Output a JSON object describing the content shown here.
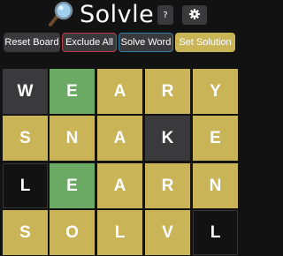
{
  "app": {
    "title": "Solvle",
    "help_label": "?",
    "icons": {
      "title": "magnifier-icon",
      "settings": "gear-icon"
    }
  },
  "toolbar": {
    "reset_label": "Reset Board",
    "exclude_label": "Exclude All",
    "solve_label": "Solve Word",
    "set_label": "Set Solution"
  },
  "colors": {
    "yellow": "#c9b458",
    "green": "#6aaa64",
    "gray": "#3a3a3c",
    "black": "#121213"
  },
  "board": {
    "rows": [
      [
        {
          "letter": "W",
          "state": "gray"
        },
        {
          "letter": "E",
          "state": "green"
        },
        {
          "letter": "A",
          "state": "yellow"
        },
        {
          "letter": "R",
          "state": "yellow"
        },
        {
          "letter": "Y",
          "state": "yellow"
        }
      ],
      [
        {
          "letter": "S",
          "state": "yellow"
        },
        {
          "letter": "N",
          "state": "yellow"
        },
        {
          "letter": "A",
          "state": "yellow"
        },
        {
          "letter": "K",
          "state": "gray"
        },
        {
          "letter": "E",
          "state": "yellow"
        }
      ],
      [
        {
          "letter": "L",
          "state": "black"
        },
        {
          "letter": "E",
          "state": "green"
        },
        {
          "letter": "A",
          "state": "yellow"
        },
        {
          "letter": "R",
          "state": "yellow"
        },
        {
          "letter": "N",
          "state": "yellow"
        }
      ],
      [
        {
          "letter": "S",
          "state": "yellow"
        },
        {
          "letter": "O",
          "state": "yellow"
        },
        {
          "letter": "L",
          "state": "yellow"
        },
        {
          "letter": "V",
          "state": "yellow"
        },
        {
          "letter": "L",
          "state": "black"
        }
      ]
    ]
  }
}
